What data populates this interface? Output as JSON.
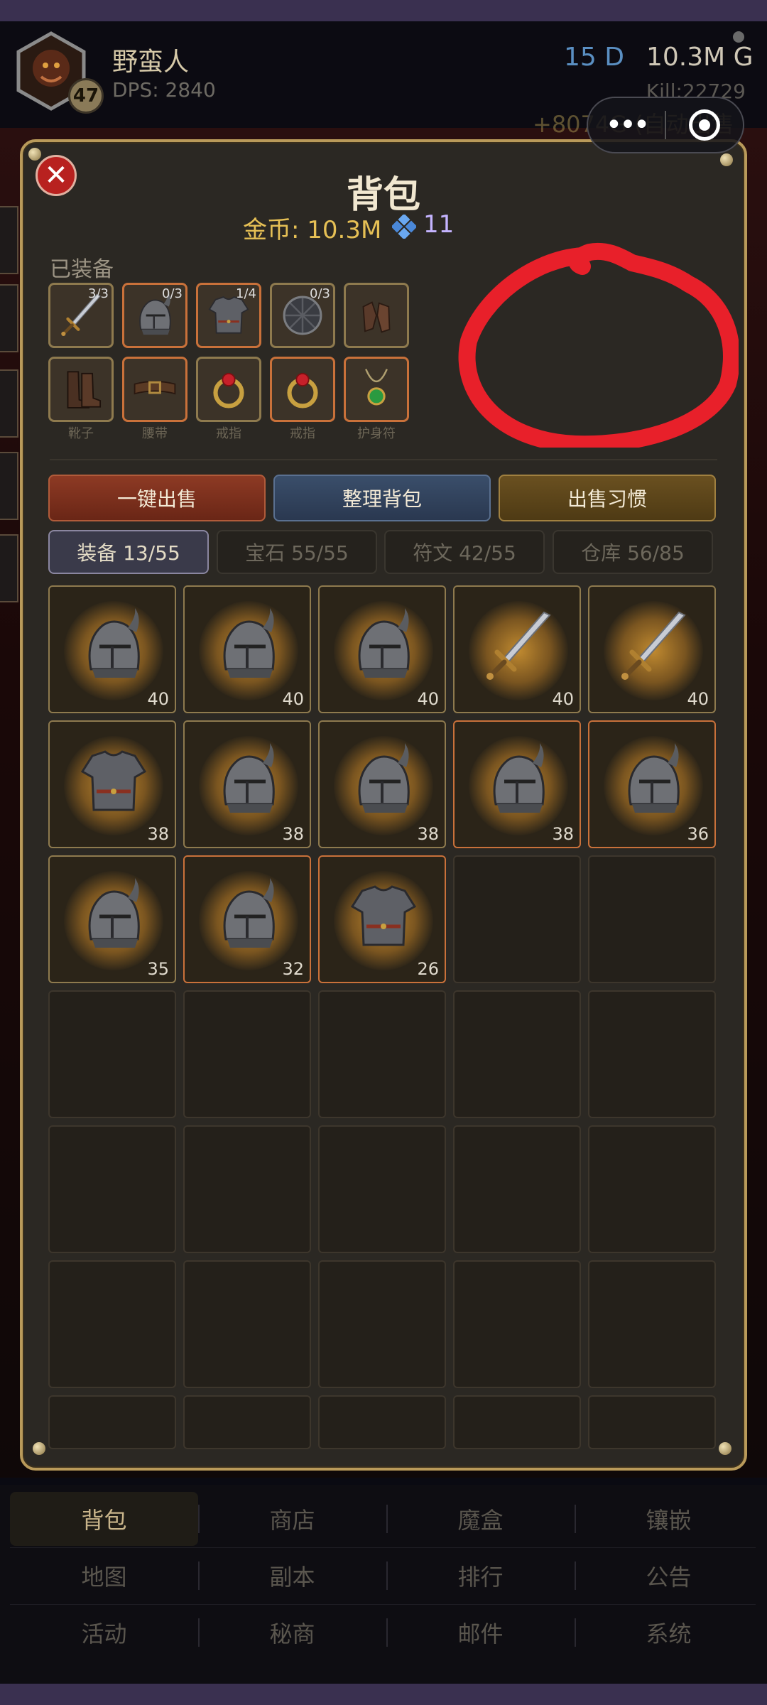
{
  "header": {
    "hero_name": "野蛮人",
    "level": "47",
    "dps": "DPS: 2840",
    "diamonds": "15 D",
    "gold": "10.3M G",
    "kills": "Kill:22729",
    "income": "+8074G (自动出售"
  },
  "panel": {
    "title": "背包",
    "gold_label": "金币: 10.3M",
    "gems": "11",
    "equipped_label": "已装备",
    "equipped": [
      {
        "icon": "sword-icon",
        "count": "3/3",
        "label": "",
        "rarity": "gold"
      },
      {
        "icon": "helmet-icon",
        "count": "0/3",
        "label": "",
        "rarity": "orange"
      },
      {
        "icon": "armor-icon",
        "count": "1/4",
        "label": "",
        "rarity": "orange"
      },
      {
        "icon": "shield-icon",
        "count": "0/3",
        "label": "",
        "rarity": "gold"
      },
      {
        "icon": "gloves-icon",
        "count": "",
        "label": "",
        "rarity": "gold"
      },
      {
        "icon": "boots-icon",
        "count": "",
        "label": "靴子",
        "rarity": "gold"
      },
      {
        "icon": "belt-icon",
        "count": "",
        "label": "腰带",
        "rarity": "orange"
      },
      {
        "icon": "ring-icon",
        "count": "",
        "label": "戒指",
        "rarity": "gold"
      },
      {
        "icon": "ring-icon",
        "count": "",
        "label": "戒指",
        "rarity": "orange"
      },
      {
        "icon": "amulet-icon",
        "count": "",
        "label": "护身符",
        "rarity": "orange"
      }
    ],
    "actions": {
      "sell_all": "一键出售",
      "sort": "整理背包",
      "sell_habit": "出售习惯"
    },
    "tabs": [
      "装备 13/55",
      "宝石 55/55",
      "符文 42/55",
      "仓库 56/85"
    ],
    "items": [
      {
        "icon": "helmet-icon",
        "level": "40",
        "rarity": "gold"
      },
      {
        "icon": "helmet-icon",
        "level": "40",
        "rarity": "gold"
      },
      {
        "icon": "helmet-icon",
        "level": "40",
        "rarity": "gold"
      },
      {
        "icon": "sword-icon",
        "level": "40",
        "rarity": "gold"
      },
      {
        "icon": "sword-icon",
        "level": "40",
        "rarity": "gold"
      },
      {
        "icon": "armor-icon",
        "level": "38",
        "rarity": "gold"
      },
      {
        "icon": "helmet-icon",
        "level": "38",
        "rarity": "gold"
      },
      {
        "icon": "helmet-icon",
        "level": "38",
        "rarity": "gold"
      },
      {
        "icon": "helmet-icon",
        "level": "38",
        "rarity": "orange"
      },
      {
        "icon": "helmet-icon",
        "level": "36",
        "rarity": "orange"
      },
      {
        "icon": "helmet-icon",
        "level": "35",
        "rarity": "gold"
      },
      {
        "icon": "helmet-icon",
        "level": "32",
        "rarity": "orange"
      },
      {
        "icon": "armor-icon",
        "level": "26",
        "rarity": "orange"
      }
    ]
  },
  "nav": [
    [
      "背包",
      "商店",
      "魔盒",
      "镶嵌"
    ],
    [
      "地图",
      "副本",
      "排行",
      "公告"
    ],
    [
      "活动",
      "秘商",
      "邮件",
      "系统"
    ]
  ],
  "colors": {
    "panel_border": "#b99a5a",
    "gold_text": "#e6c055",
    "annotation_red": "#e8202a",
    "rarity_orange": "#c9713a",
    "rarity_gold": "#8e7a4e"
  }
}
